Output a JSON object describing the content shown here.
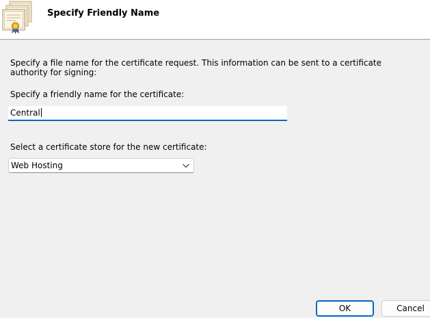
{
  "header": {
    "title": "Specify Friendly Name",
    "icon": "certificate-icon"
  },
  "main": {
    "description": "Specify a file name for the certificate request.  This information can be sent to a certificate authority for signing:",
    "friendly_name_label": "Specify a friendly name for the certificate:",
    "friendly_name_value": "Central",
    "store_label": "Select a certificate store for the new certificate:",
    "store_selected": "Web Hosting",
    "store_icon": "chevron-down-icon"
  },
  "footer": {
    "ok_label": "OK",
    "cancel_label": "Cancel"
  },
  "colors": {
    "accent": "#0067c0",
    "background": "#f0f0f0",
    "header_background": "#ffffff"
  }
}
